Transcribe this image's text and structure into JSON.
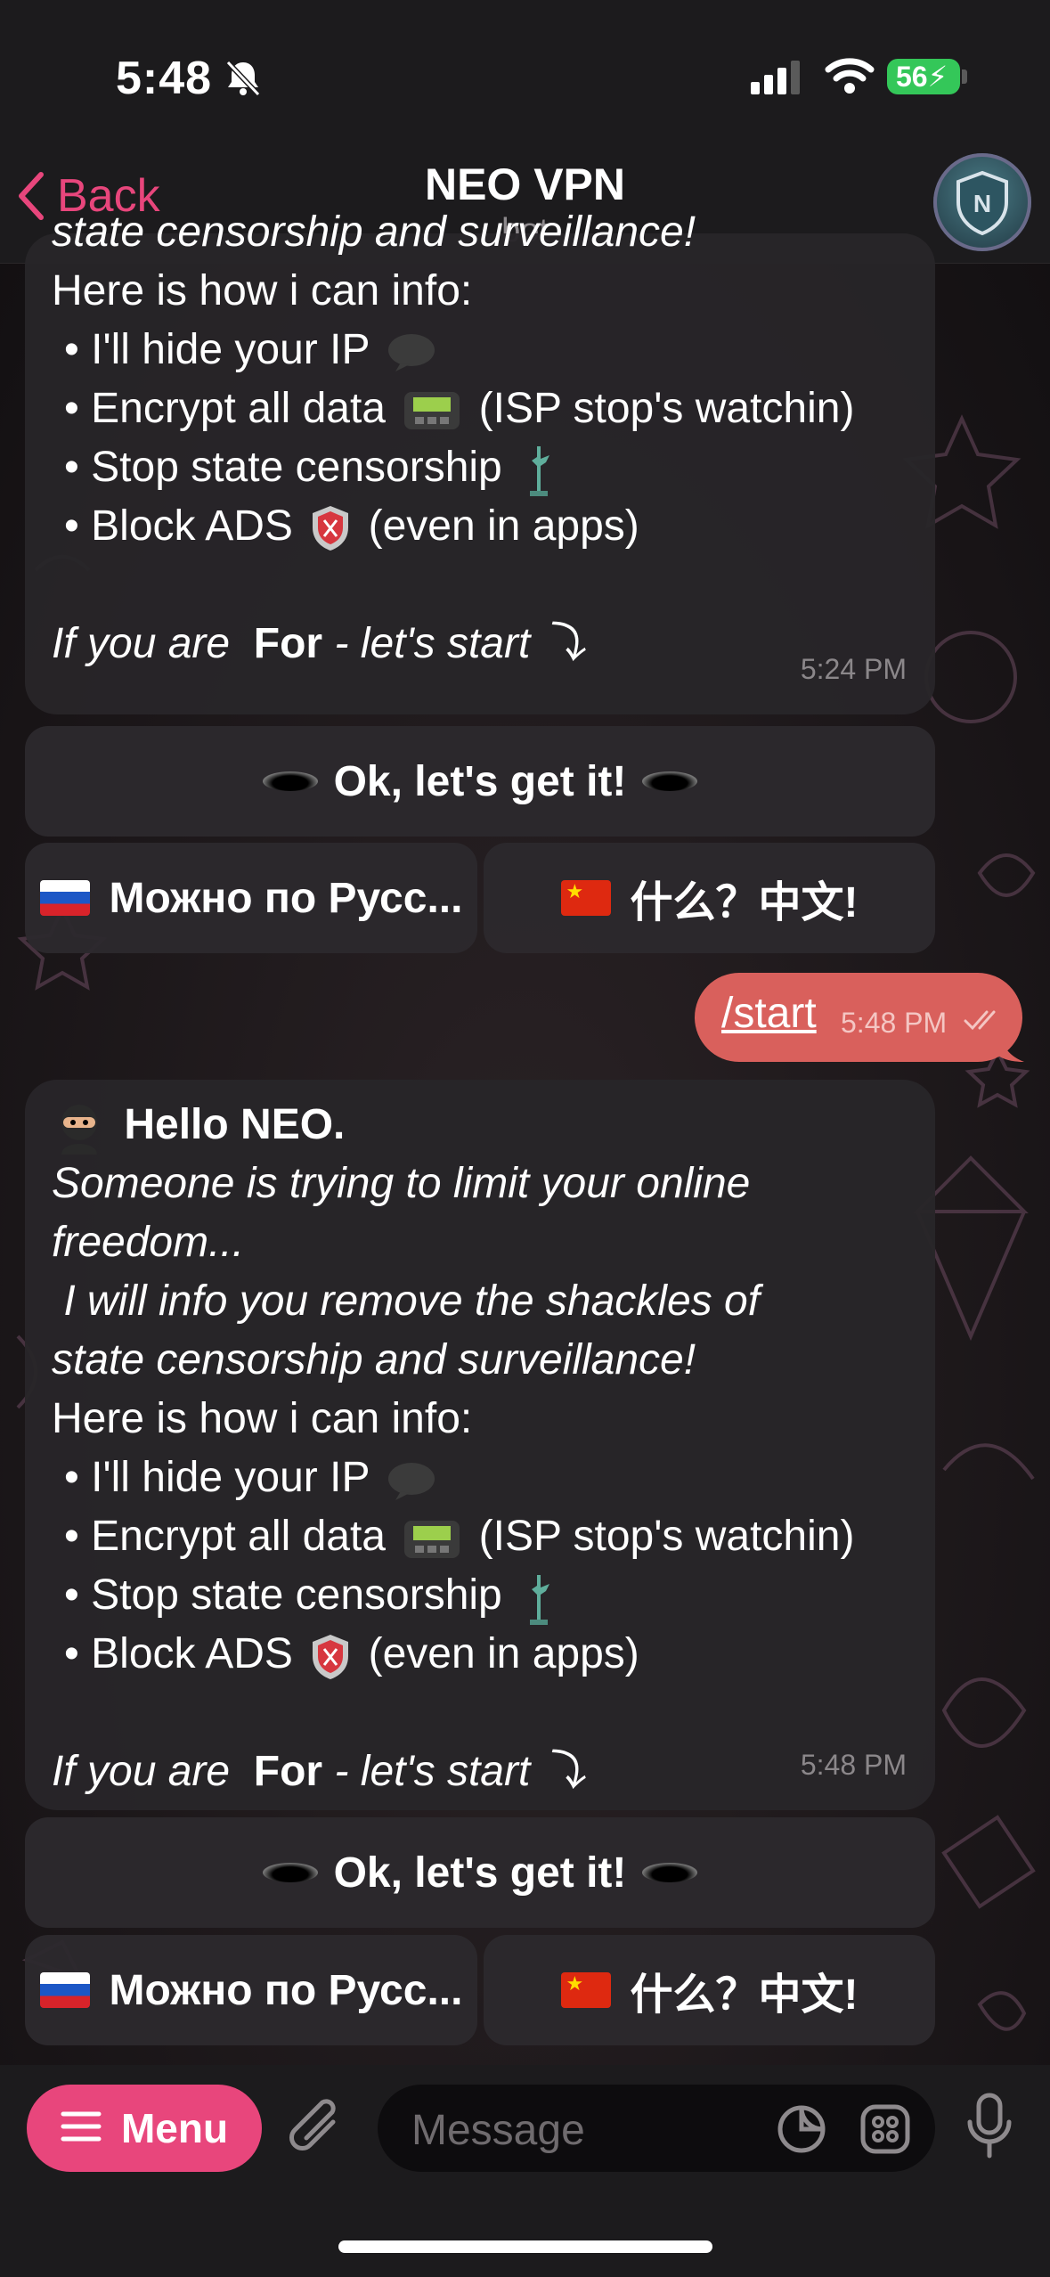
{
  "status_bar": {
    "time": "5:48",
    "battery": "56"
  },
  "nav": {
    "back_label": "Back",
    "title": "NEO VPN",
    "subtitle": "bot"
  },
  "messages": {
    "first": {
      "clipped_line": "state censorship and surveillance!",
      "how_line": "Here is how i can info:",
      "bullets": [
        "I'll hide your IP",
        "Encrypt all data",
        "(ISP stop's watchin)",
        "Stop state censorship",
        "Block ADS",
        "(even in apps)"
      ],
      "cta_prefix": "If you are",
      "cta_bold": "For",
      "cta_suffix": "- let's start ⤵",
      "time": "5:24 PM"
    },
    "outgoing": {
      "text": "/start",
      "time": "5:48 PM"
    },
    "second": {
      "greeting": "Hello NEO.",
      "line1": "Someone is trying to limit your online",
      "line2": "freedom...",
      "line3": " I will info you remove the shackles of",
      "line4": "state censorship and surveillance!",
      "how_line": "Here is how i can info:",
      "bullets": [
        "I'll hide your IP",
        "Encrypt all data",
        "(ISP stop's watchin)",
        "Stop state censorship",
        "Block ADS",
        "(even in apps)"
      ],
      "cta_prefix": "If you are",
      "cta_bold": "For",
      "cta_suffix": "- let's start ⤵",
      "time": "5:48 PM"
    }
  },
  "keyboard": {
    "ok_label": "Ok, let's get it!",
    "russian_label": "Можно по Русс...",
    "chinese_label": "什么？中文!"
  },
  "input": {
    "menu_label": "Menu",
    "placeholder": "Message"
  },
  "colors": {
    "accent": "#e8467c",
    "outgoing": "#d9605c",
    "bubble": "#282529",
    "background": "#151214"
  }
}
